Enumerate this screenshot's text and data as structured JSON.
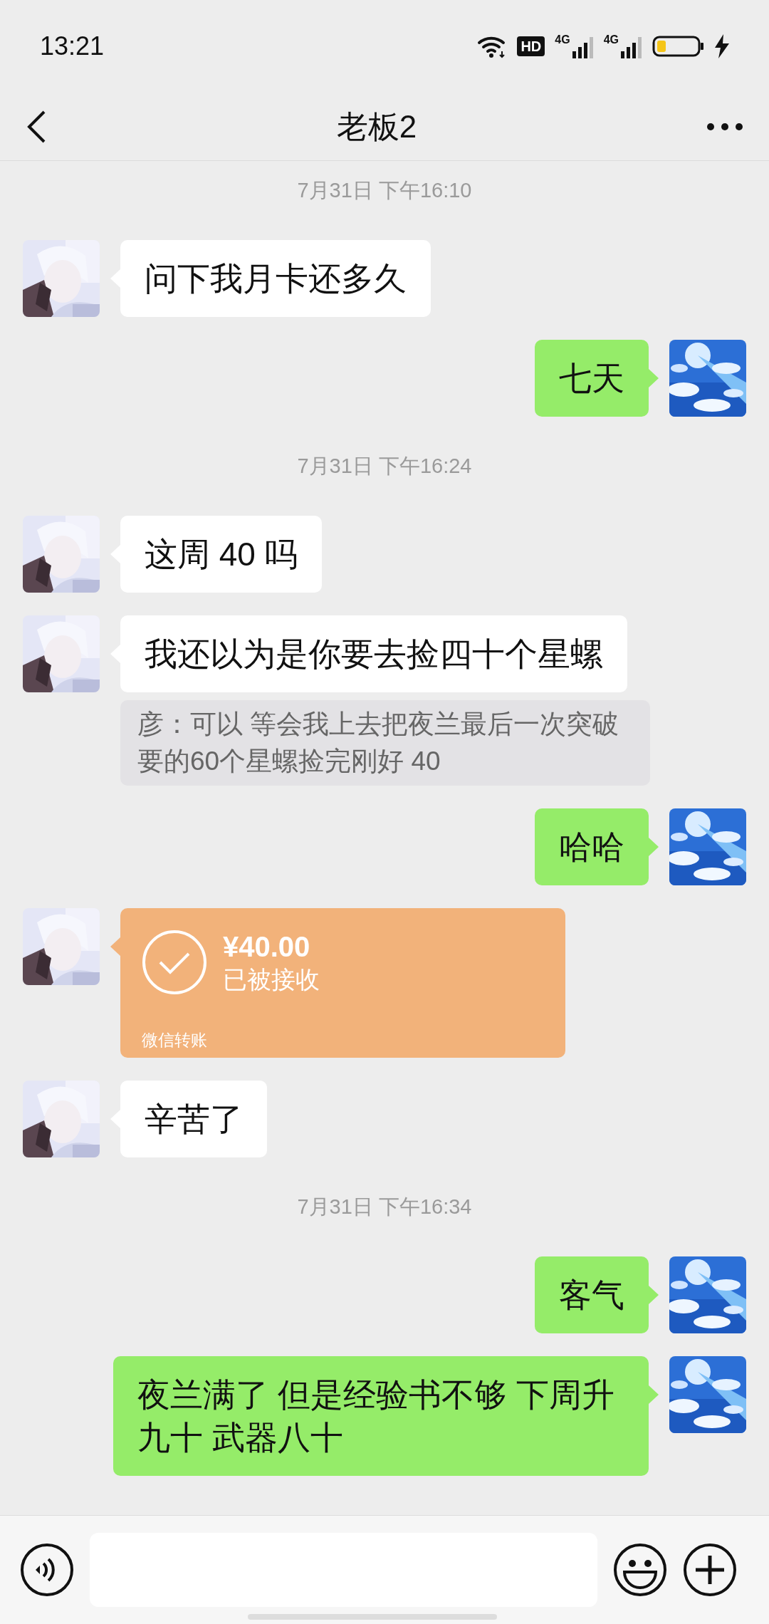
{
  "status_bar": {
    "time": "13:21",
    "network_badge": "HD",
    "network_1": "4G",
    "network_2": "4G"
  },
  "header": {
    "title": "老板2"
  },
  "messages": [
    {
      "kind": "time",
      "text": "7月31日 下午16:10"
    },
    {
      "kind": "text",
      "outgoing": false,
      "text": "问下我月卡还多久"
    },
    {
      "kind": "text",
      "outgoing": true,
      "text": "七天"
    },
    {
      "kind": "time",
      "text": "7月31日 下午16:24"
    },
    {
      "kind": "text",
      "outgoing": false,
      "text": "这周 40 吗"
    },
    {
      "kind": "text",
      "outgoing": false,
      "text": "我还以为是你要去捡四十个星螺"
    },
    {
      "kind": "quote",
      "text": "彦：可以 等会我上去把夜兰最后一次突破要的60个星螺捡完刚好 40"
    },
    {
      "kind": "text",
      "outgoing": true,
      "text": "哈哈"
    },
    {
      "kind": "transfer",
      "amount": "¥40.00",
      "status": "已被接收",
      "footer": "微信转账"
    },
    {
      "kind": "text",
      "outgoing": false,
      "text": "辛苦了"
    },
    {
      "kind": "time",
      "text": "7月31日 下午16:34"
    },
    {
      "kind": "text",
      "outgoing": true,
      "text": "客气"
    },
    {
      "kind": "text",
      "outgoing": true,
      "text": "夜兰满了 但是经验书不够 下周升九十 武器八十"
    }
  ]
}
